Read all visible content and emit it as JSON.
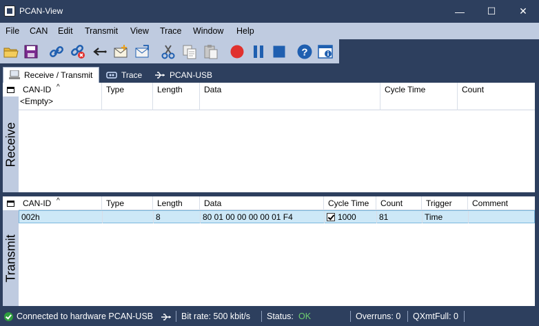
{
  "window": {
    "title": "PCAN-View",
    "minimize": "—",
    "maximize": "☐",
    "close": "✕"
  },
  "menu": [
    "File",
    "CAN",
    "Edit",
    "Transmit",
    "View",
    "Trace",
    "Window",
    "Help"
  ],
  "tabs": [
    {
      "label": "Receive / Transmit",
      "icon": "receive-transmit-icon",
      "active": true
    },
    {
      "label": "Trace",
      "icon": "trace-icon",
      "active": false
    },
    {
      "label": "PCAN-USB",
      "icon": "usb-icon",
      "active": false
    }
  ],
  "receive": {
    "panel_label": "Receive",
    "columns": [
      "CAN-ID",
      "Type",
      "Length",
      "Data",
      "Cycle Time",
      "Count"
    ],
    "empty_text": "<Empty>"
  },
  "transmit": {
    "panel_label": "Transmit",
    "columns": [
      "CAN-ID",
      "Type",
      "Length",
      "Data",
      "Cycle Time",
      "Count",
      "Trigger",
      "Comment"
    ],
    "rows": [
      {
        "can_id": "002h",
        "type": "",
        "length": "8",
        "data": "80 01 00 00 00 00 01 F4",
        "cycle_checked": true,
        "cycle_time": "1000",
        "count": "81",
        "trigger": "Time",
        "comment": ""
      }
    ]
  },
  "status": {
    "connection": "Connected to hardware PCAN-USB",
    "bitrate": "Bit rate: 500 kbit/s",
    "status_label": "Status:",
    "status_value": "OK",
    "status_color": "#6fd06f",
    "overruns": "Overruns: 0",
    "qxmtfull": "QXmtFull: 0"
  },
  "colors": {
    "chrome": "#2d3f5e",
    "bars": "#bfcbe0",
    "selection": "#cde8f7",
    "record": "#e0312e",
    "accent": "#1f5fb0"
  }
}
